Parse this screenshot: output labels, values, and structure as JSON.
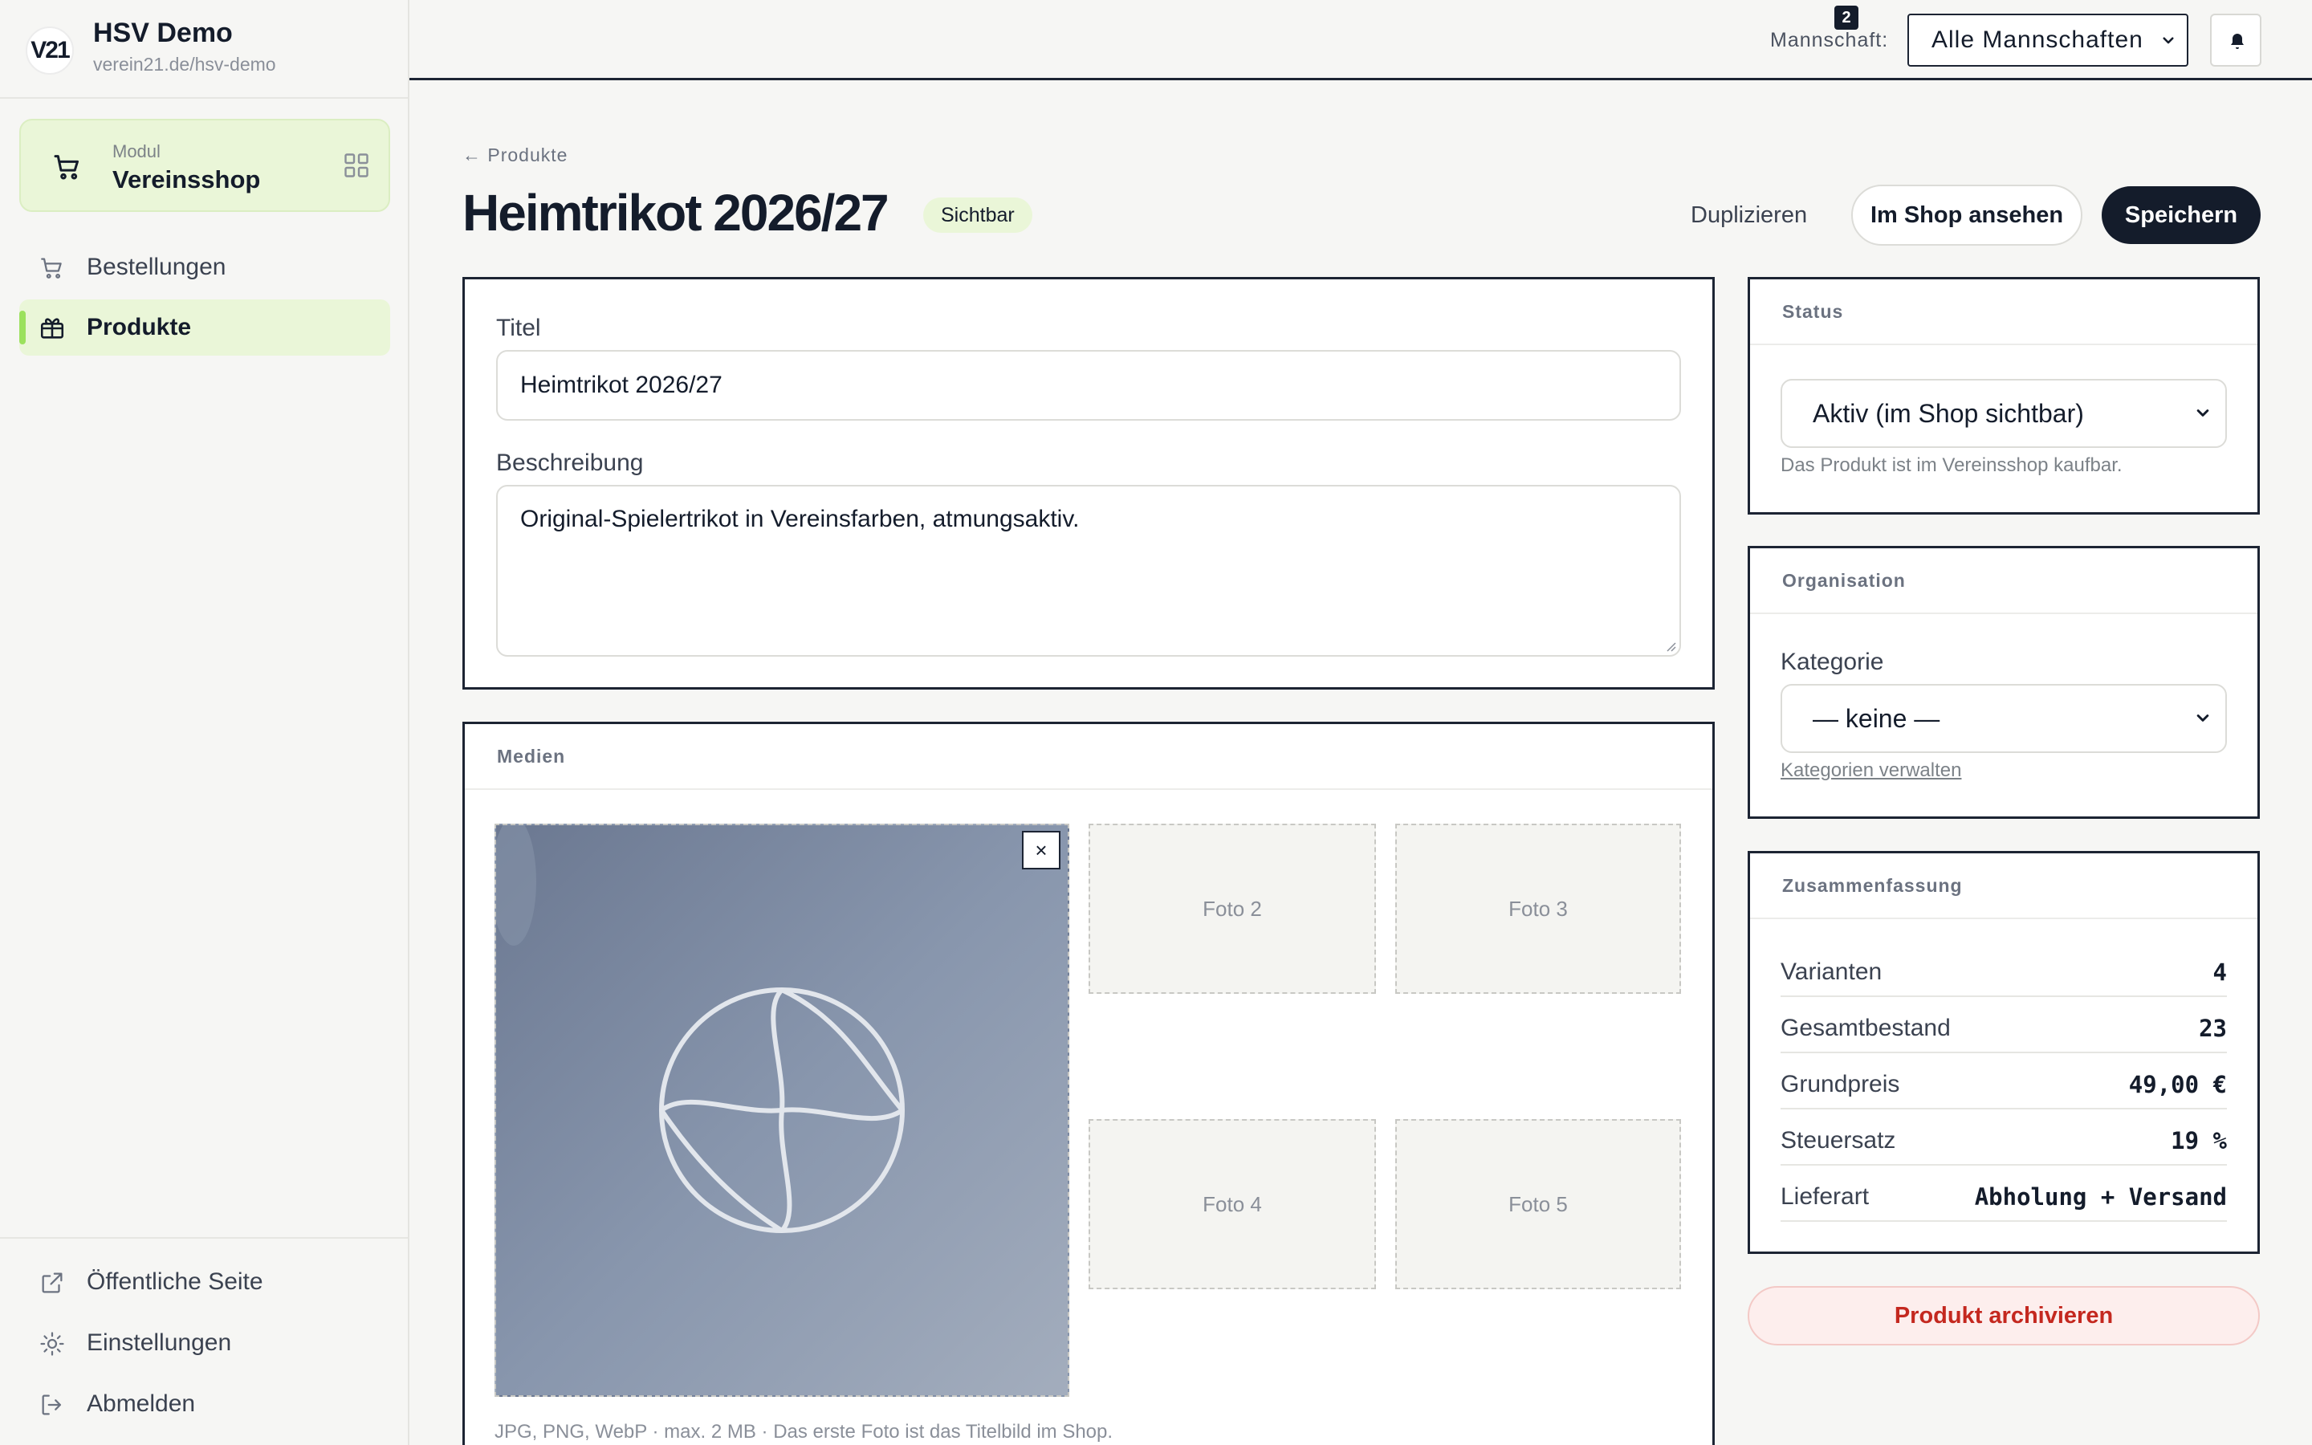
{
  "brand": {
    "logo_text": "V21",
    "name": "HSV Demo",
    "url": "verein21.de/hsv-demo"
  },
  "module": {
    "label": "Modul",
    "name": "Vereinsshop"
  },
  "nav": {
    "orders": "Bestellungen",
    "products": "Produkte",
    "public_page": "Öffentliche Seite",
    "settings": "Einstellungen",
    "logout": "Abmelden"
  },
  "topbar": {
    "team_label": "Mannschaft:",
    "team_value": "Alle Mannschaften",
    "notifications_count": "2"
  },
  "header": {
    "breadcrumb": "← Produkte",
    "title": "Heimtrikot 2026/27",
    "visibility_badge": "Sichtbar",
    "duplicate": "Duplizieren",
    "view_in_shop": "Im Shop ansehen",
    "save": "Speichern"
  },
  "form": {
    "title_label": "Titel",
    "title_value": "Heimtrikot 2026/27",
    "description_label": "Beschreibung",
    "description_value": "Original-Spielertrikot in Vereinsfarben, atmungsaktiv."
  },
  "media": {
    "heading": "Medien",
    "remove": "×",
    "slots": [
      "Foto 2",
      "Foto 3",
      "Foto 4",
      "Foto 5"
    ],
    "help": "JPG, PNG, WebP · max. 2 MB · Das erste Foto ist das Titelbild im Shop."
  },
  "status": {
    "heading": "Status",
    "value": "Aktiv (im Shop sichtbar)",
    "hint": "Das Produkt ist im Vereinsshop kaufbar."
  },
  "organisation": {
    "heading": "Organisation",
    "category_label": "Kategorie",
    "category_value": "— keine —",
    "manage_link": "Kategorien verwalten"
  },
  "summary": {
    "heading": "Zusammenfassung",
    "rows": [
      {
        "key": "Varianten",
        "value": "4"
      },
      {
        "key": "Gesamtbestand",
        "value": "23"
      },
      {
        "key": "Grundpreis",
        "value": "49,00 €"
      },
      {
        "key": "Steuersatz",
        "value": "19 %"
      },
      {
        "key": "Lieferart",
        "value": "Abholung + Versand"
      }
    ]
  },
  "archive": "Produkt archivieren",
  "colors": {
    "accent": "#9be15d",
    "accent_bg": "#eaf6d8",
    "dark": "#141c2b",
    "danger": "#c4281f"
  }
}
